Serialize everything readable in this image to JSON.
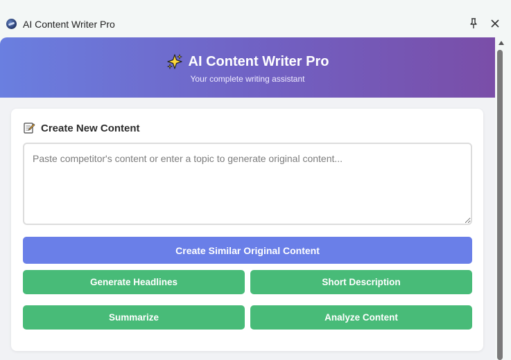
{
  "window": {
    "title": "AI Content Writer Pro",
    "icons": [
      "app-logo-icon",
      "pin-icon",
      "close-icon"
    ]
  },
  "header": {
    "title": "AI Content Writer Pro",
    "subtitle": "Your complete writing assistant",
    "icon": "sparkle-icon",
    "gradient": [
      "#6a7fe0",
      "#7a4ea8"
    ]
  },
  "card": {
    "title": "Create New Content",
    "icon": "memo-icon",
    "input": {
      "value": "",
      "placeholder": "Paste competitor's content or enter a topic to generate original content..."
    }
  },
  "actions": {
    "primary_label": "Create Similar Original Content",
    "headlines_label": "Generate Headlines",
    "short_desc_label": "Short Description",
    "summarize_label": "Summarize",
    "analyze_label": "Analyze Content"
  },
  "colors": {
    "primary": "#6a7fe8",
    "success": "#48bb78"
  }
}
